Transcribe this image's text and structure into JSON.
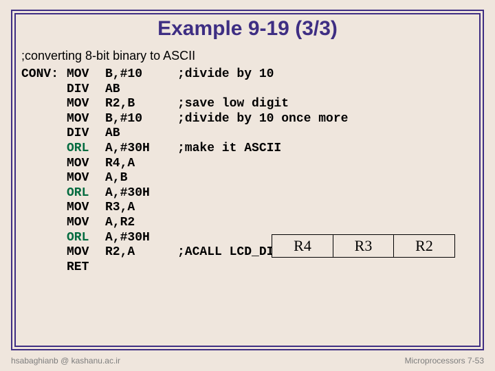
{
  "title": "Example 9-19 (3/3)",
  "subtitle": ";converting 8-bit binary to ASCII",
  "code": [
    {
      "label": "CONV:",
      "mnem": "MOV",
      "args": "B,#10",
      "cmt": ";divide by 10",
      "green": false
    },
    {
      "label": "",
      "mnem": "DIV",
      "args": "AB",
      "cmt": "",
      "green": false
    },
    {
      "label": "",
      "mnem": "MOV",
      "args": "R2,B",
      "cmt": ";save low digit",
      "green": false
    },
    {
      "label": "",
      "mnem": "MOV",
      "args": "B,#10",
      "cmt": ";divide by 10 once more",
      "green": false
    },
    {
      "label": "",
      "mnem": "DIV",
      "args": "AB",
      "cmt": "",
      "green": false
    },
    {
      "label": "",
      "mnem": "ORL",
      "args": "A,#30H",
      "cmt": ";make it ASCII",
      "green": true
    },
    {
      "label": "",
      "mnem": "MOV",
      "args": "R4,A",
      "cmt": "",
      "green": false
    },
    {
      "label": "",
      "mnem": "MOV",
      "args": "A,B",
      "cmt": "",
      "green": false
    },
    {
      "label": "",
      "mnem": "ORL",
      "args": "A,#30H",
      "cmt": "",
      "green": true
    },
    {
      "label": "",
      "mnem": "MOV",
      "args": "R3,A",
      "cmt": "",
      "green": false
    },
    {
      "label": "",
      "mnem": "MOV",
      "args": "A,R2",
      "cmt": "",
      "green": false
    },
    {
      "label": "",
      "mnem": "ORL",
      "args": "A,#30H",
      "cmt": "",
      "green": true
    },
    {
      "label": "",
      "mnem": "MOV",
      "args": "R2,A",
      "cmt": ";ACALL LCD_DISPLAY here",
      "green": false
    },
    {
      "label": "",
      "mnem": "RET",
      "args": "",
      "cmt": "",
      "green": false
    }
  ],
  "registers": [
    "R4",
    "R3",
    "R2"
  ],
  "footer": {
    "left": "hsabaghianb @ kashanu.ac.ir",
    "right_label": "Microprocessors",
    "right_page": "7-53"
  }
}
